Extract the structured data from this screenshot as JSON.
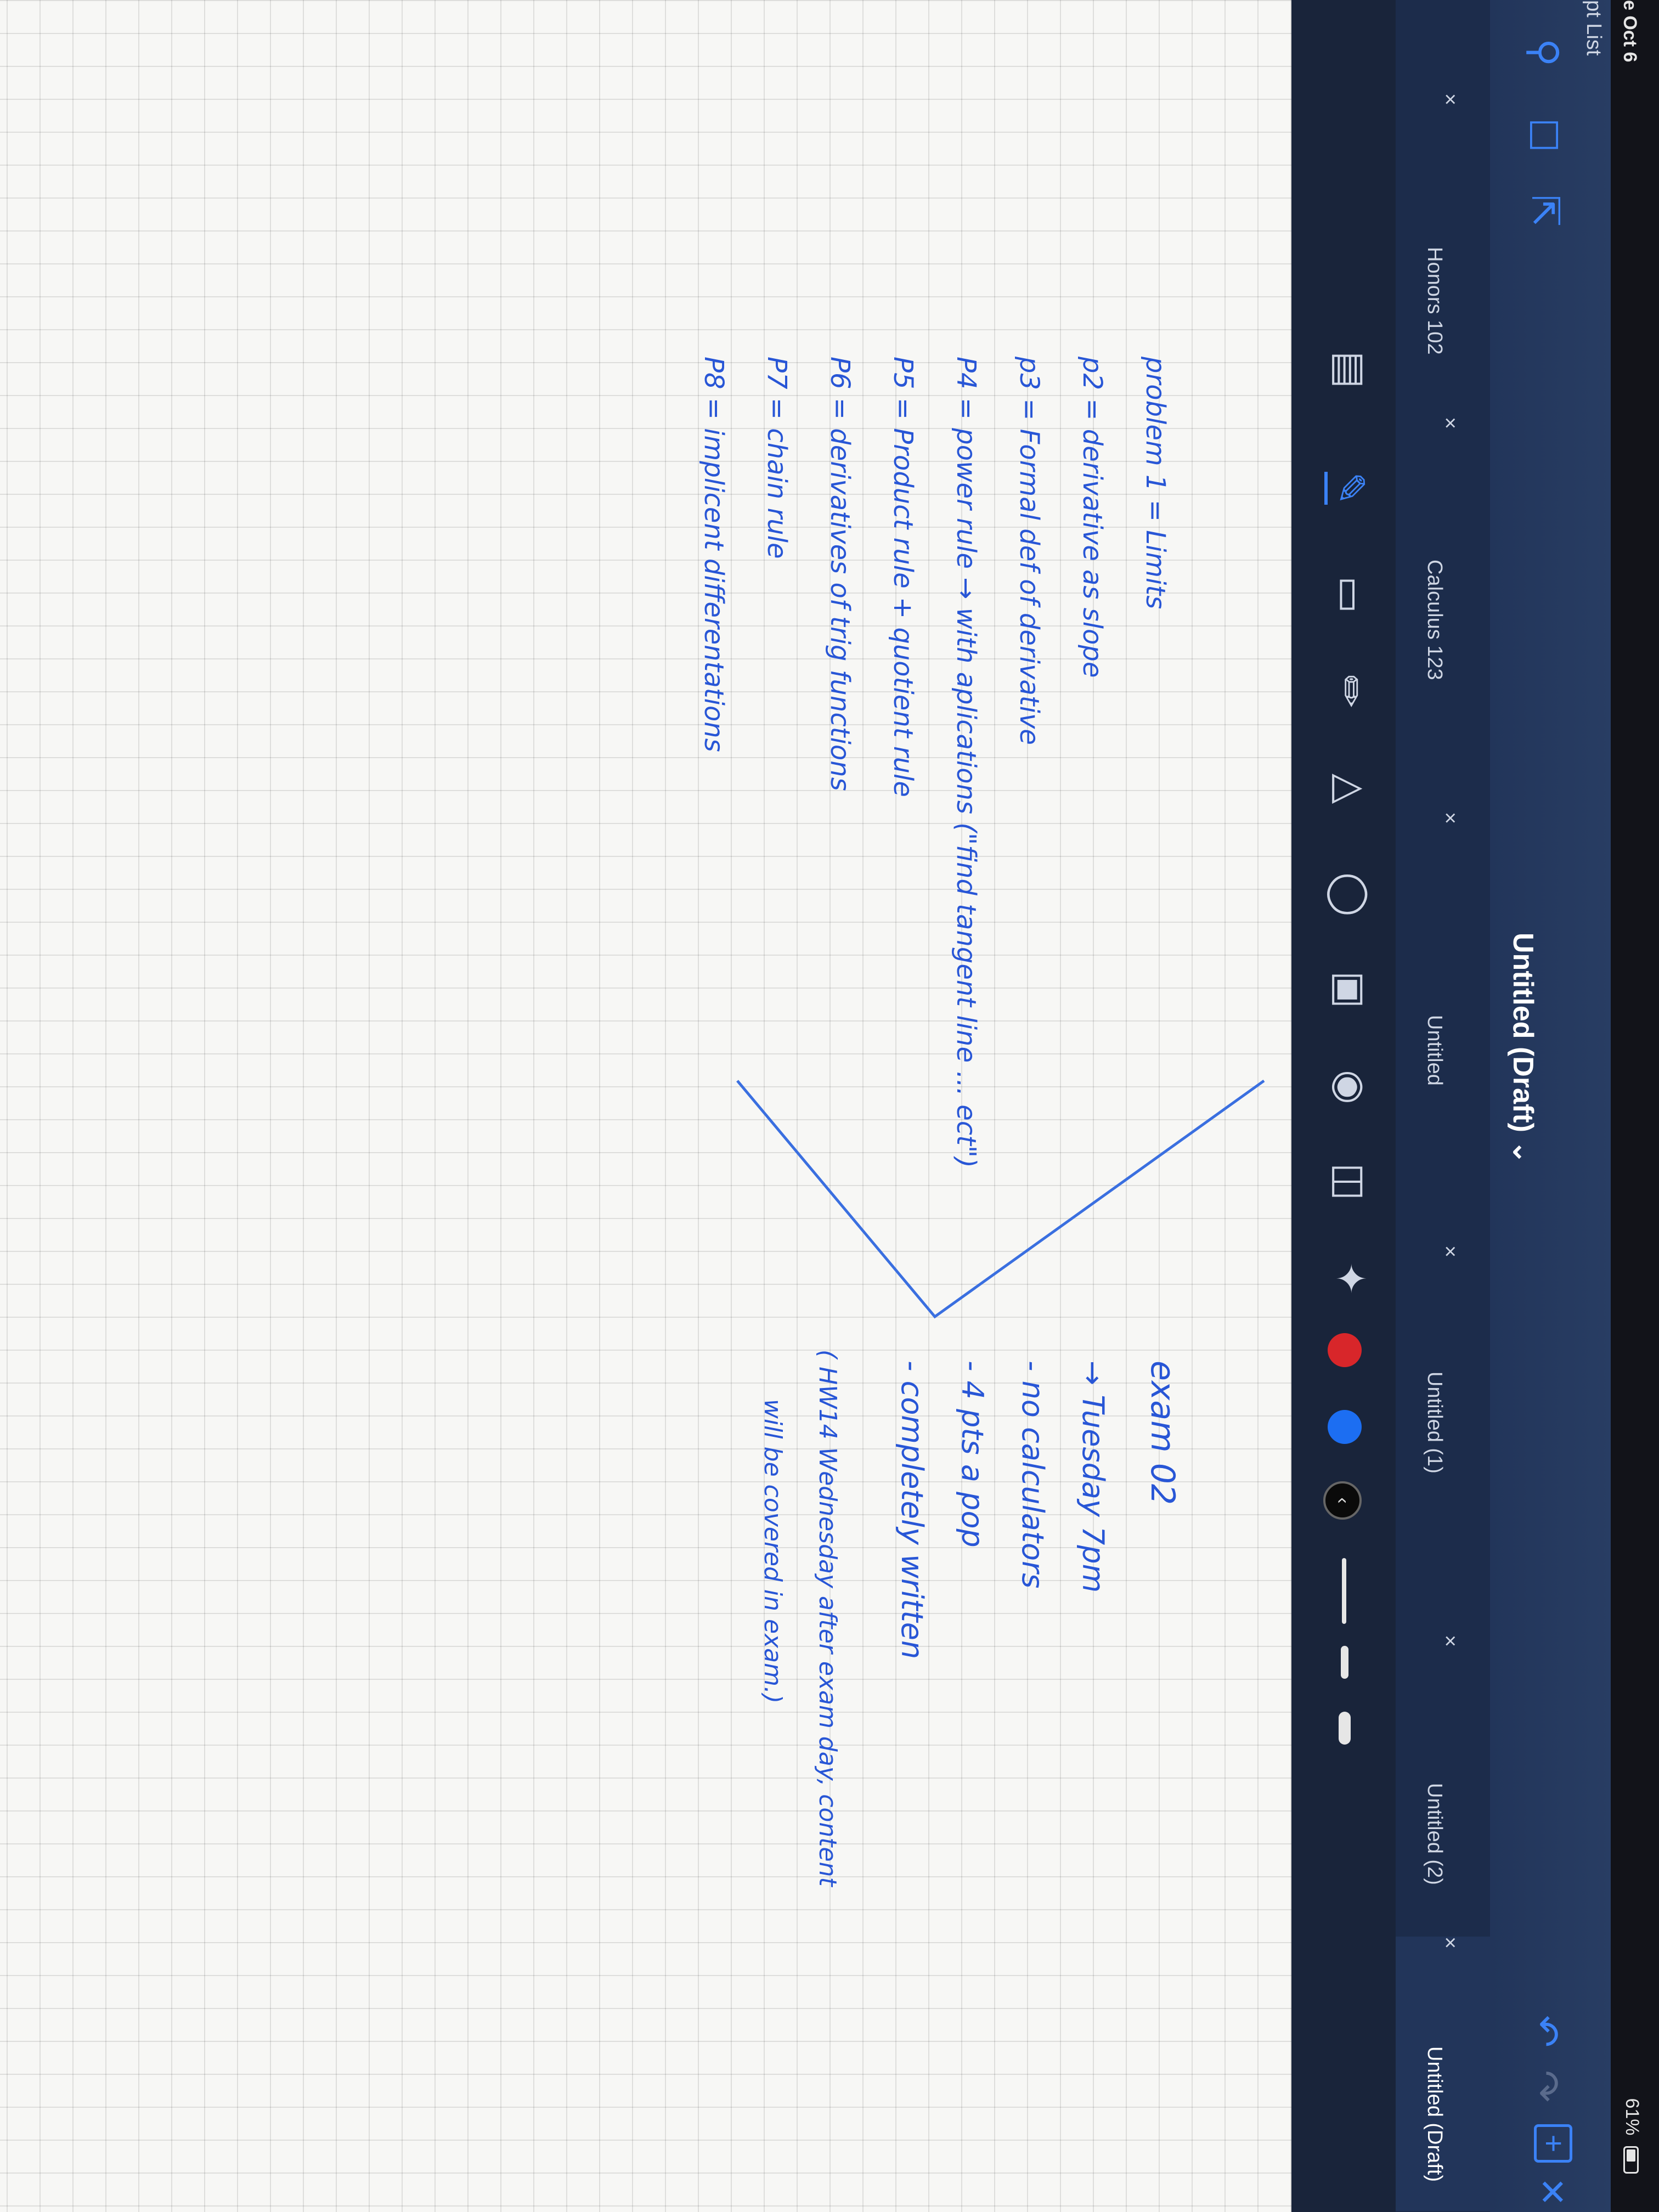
{
  "status_bar": {
    "date": "e Oct 6",
    "battery": "61%"
  },
  "sidebar": {
    "partial_label": "pt List"
  },
  "navbar": {
    "title": "Untitled (Draft)",
    "title_chevron": "⌄",
    "icons": [
      "search-icon",
      "bookmark-icon",
      "export-icon",
      "undo-icon",
      "redo-icon",
      "add-page-icon",
      "close-icon"
    ]
  },
  "tabs": [
    {
      "label": "Honors 102",
      "close": "×"
    },
    {
      "label": "Calculus 123",
      "close": "×"
    },
    {
      "label": "Untitled",
      "close": "×"
    },
    {
      "label": "Untitled (1)",
      "close": "×"
    },
    {
      "label": "Untitled (2)",
      "close": "×"
    },
    {
      "label": "Untitled (Draft)",
      "close": "×"
    }
  ],
  "toolbar": {
    "tools": [
      "read-only-icon",
      "pen-icon",
      "eraser-icon",
      "highlighter-icon",
      "shapes-icon",
      "lasso-icon",
      "image-icon",
      "camera-icon",
      "text-icon",
      "laser-pointer-icon"
    ],
    "colors": [
      "#d8262a",
      "#1c6ef2",
      "#0a0a0a"
    ],
    "colors_chevron": "‹"
  },
  "note": {
    "left_lines": [
      "problem 1 = Limits",
      "p2 =  derivative as slope",
      "p3 =  Formal def of derivative",
      "P4 =  power rule → with aplications (\"find tangent line ... ect\")",
      "P5 =  Product rule + quotient rule",
      "P6 =  derivatives of trig functions",
      "P7 =  chain rule",
      "P8 =  implicent differentations"
    ],
    "exam_title": "exam 02",
    "exam_lines": [
      "→ Tuesday 7pm",
      "- no calculators",
      "- 4 pts a pop",
      "- completely written"
    ],
    "hw_lines": [
      "( HW14 Wednesday after exam day, content",
      "will be covered in exam.)"
    ]
  }
}
